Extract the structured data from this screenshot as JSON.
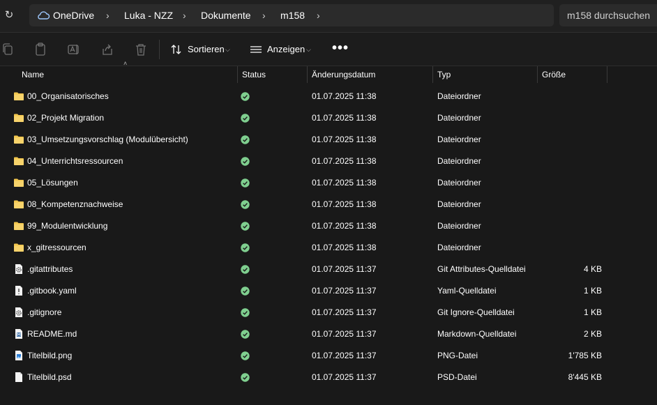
{
  "breadcrumb": [
    "OneDrive",
    "Luka - NZZ",
    "Dokumente",
    "m158"
  ],
  "search": {
    "placeholder": "m158 durchsuchen"
  },
  "toolbar": {
    "sort_label": "Sortieren",
    "view_label": "Anzeigen",
    "more_label": "•••"
  },
  "columns": {
    "name": "Name",
    "status": "Status",
    "modified": "Änderungsdatum",
    "type": "Typ",
    "size": "Größe"
  },
  "colors": {
    "background": "#191919",
    "folder": "#f2c64d",
    "status_ok": "#7fcf8f"
  },
  "files": [
    {
      "name": "00_Organisatorisches",
      "icon": "folder-icon",
      "status": "synced",
      "modified": "01.07.2025 11:38",
      "type": "Dateiordner",
      "size": ""
    },
    {
      "name": "02_Projekt Migration",
      "icon": "folder-icon",
      "status": "synced",
      "modified": "01.07.2025 11:38",
      "type": "Dateiordner",
      "size": ""
    },
    {
      "name": "03_Umsetzungsvorschlag (Modulübersicht)",
      "icon": "folder-icon",
      "status": "synced",
      "modified": "01.07.2025 11:38",
      "type": "Dateiordner",
      "size": ""
    },
    {
      "name": "04_Unterrichtsressourcen",
      "icon": "folder-icon",
      "status": "synced",
      "modified": "01.07.2025 11:38",
      "type": "Dateiordner",
      "size": ""
    },
    {
      "name": "05_Lösungen",
      "icon": "folder-icon",
      "status": "synced",
      "modified": "01.07.2025 11:38",
      "type": "Dateiordner",
      "size": ""
    },
    {
      "name": "08_Kompetenznachweise",
      "icon": "folder-icon",
      "status": "synced",
      "modified": "01.07.2025 11:38",
      "type": "Dateiordner",
      "size": ""
    },
    {
      "name": "99_Modulentwicklung",
      "icon": "folder-icon",
      "status": "synced",
      "modified": "01.07.2025 11:38",
      "type": "Dateiordner",
      "size": ""
    },
    {
      "name": "x_gitressourcen",
      "icon": "folder-icon",
      "status": "synced",
      "modified": "01.07.2025 11:38",
      "type": "Dateiordner",
      "size": ""
    },
    {
      "name": ".gitattributes",
      "icon": "gear-file-icon",
      "status": "synced",
      "modified": "01.07.2025 11:37",
      "type": "Git Attributes-Quelldatei",
      "size": "4 KB"
    },
    {
      "name": ".gitbook.yaml",
      "icon": "script-file-icon",
      "status": "synced",
      "modified": "01.07.2025 11:37",
      "type": "Yaml-Quelldatei",
      "size": "1 KB"
    },
    {
      "name": ".gitignore",
      "icon": "gear-file-icon",
      "status": "synced",
      "modified": "01.07.2025 11:37",
      "type": "Git Ignore-Quelldatei",
      "size": "1 KB"
    },
    {
      "name": "README.md",
      "icon": "markdown-file-icon",
      "status": "synced",
      "modified": "01.07.2025 11:37",
      "type": "Markdown-Quelldatei",
      "size": "2 KB"
    },
    {
      "name": "Titelbild.png",
      "icon": "image-file-icon",
      "status": "synced",
      "modified": "01.07.2025 11:37",
      "type": "PNG-Datei",
      "size": "1'785 KB"
    },
    {
      "name": "Titelbild.psd",
      "icon": "blank-file-icon",
      "status": "synced",
      "modified": "01.07.2025 11:37",
      "type": "PSD-Datei",
      "size": "8'445 KB"
    }
  ]
}
